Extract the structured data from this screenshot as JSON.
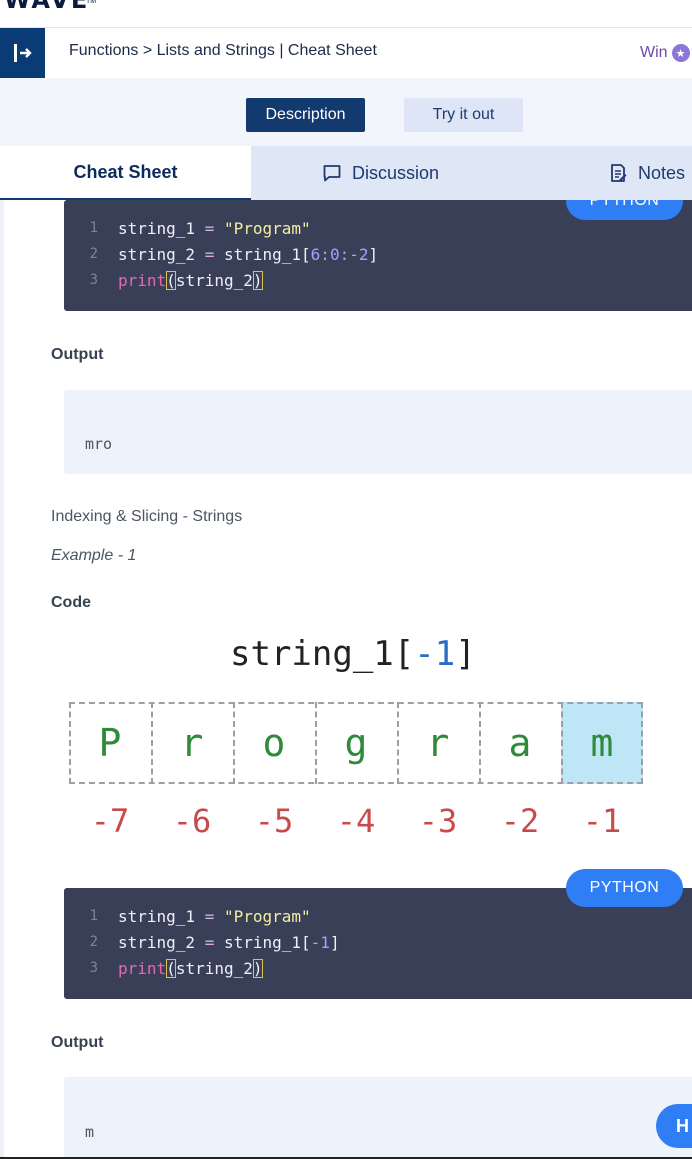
{
  "brand": {
    "logo": "WAVE",
    "tm": "TM"
  },
  "header": {
    "breadcrumb": "Functions > Lists and Strings | Cheat Sheet",
    "win_label": "Win"
  },
  "toggle": {
    "description": "Description",
    "try_it_out": "Try it out"
  },
  "tabs": {
    "cheat_sheet": "Cheat Sheet",
    "discussion": "Discussion",
    "notes": "Notes"
  },
  "blocks": {
    "badge_label": "PYTHON",
    "code1": {
      "line1": {
        "num": "1",
        "var": "string_1",
        "op": " = ",
        "str": "\"Program\""
      },
      "line2": {
        "num": "2",
        "var": "string_2",
        "op": " = ",
        "ref": "string_1",
        "open": "[",
        "slice": "6:0:-2",
        "close": "]"
      },
      "line3": {
        "num": "3",
        "fn": "print",
        "open": "(",
        "arg": "string_2",
        "close": ")"
      }
    },
    "output_label_1": "Output",
    "output_1": "mro",
    "section_title": "Indexing & Slicing - Strings",
    "example_label": "Example - 1",
    "code_label": "Code",
    "diagram": {
      "title_prefix": "string_1[",
      "title_index": "-1",
      "title_suffix": "]",
      "letters": [
        "P",
        "r",
        "o",
        "g",
        "r",
        "a",
        "m"
      ],
      "indices": [
        "-7",
        "-6",
        "-5",
        "-4",
        "-3",
        "-2",
        "-1"
      ],
      "highlight_index": 6
    },
    "code2": {
      "line1": {
        "num": "1",
        "var": "string_1",
        "op": " = ",
        "str": "\"Program\""
      },
      "line2": {
        "num": "2",
        "var": "string_2",
        "op": " = ",
        "ref": "string_1",
        "open": "[",
        "idx": "-1",
        "close": "]"
      },
      "line3": {
        "num": "3",
        "fn": "print",
        "open": "(",
        "arg": "string_2",
        "close": ")"
      }
    },
    "output_label_2": "Output",
    "output_2": "m"
  },
  "help_fab": "H",
  "colors": {
    "primary": "#123a6e",
    "accent": "#2f7ef5",
    "code_bg": "#3a3f58",
    "highlight": "#bfe6f7"
  }
}
